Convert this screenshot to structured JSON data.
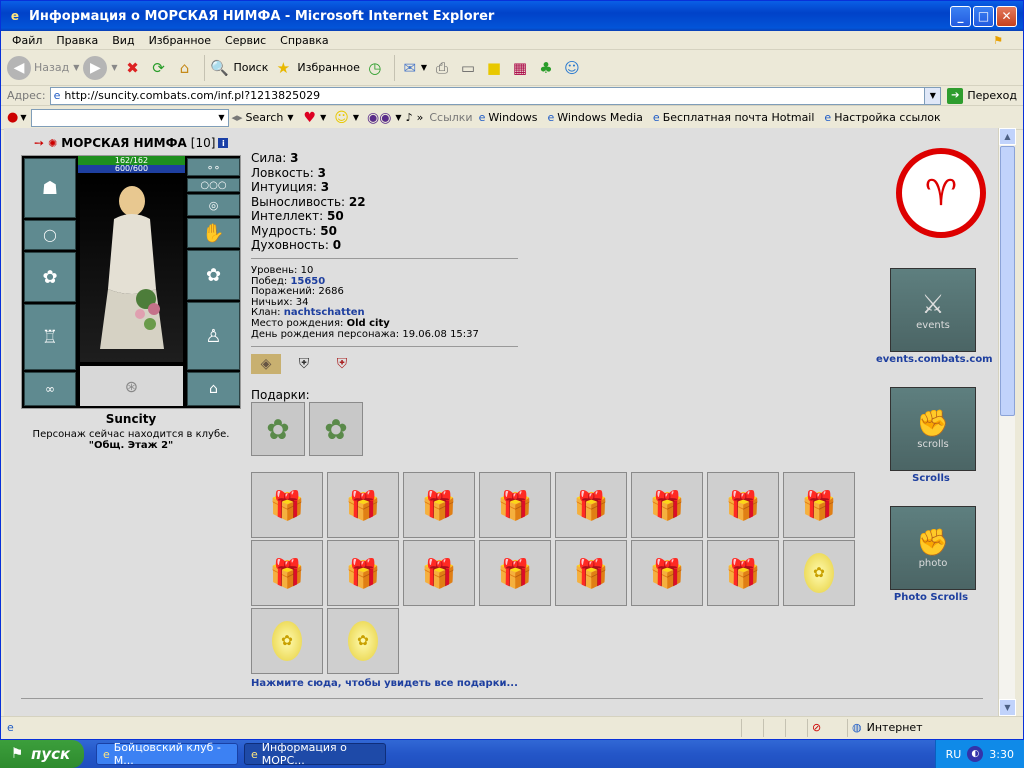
{
  "window": {
    "title": "Информация о МОРСКАЯ НИМФА - Microsoft Internet Explorer"
  },
  "menu": [
    "Файл",
    "Правка",
    "Вид",
    "Избранное",
    "Сервис",
    "Справка"
  ],
  "toolbar": {
    "back": "Назад",
    "search": "Поиск",
    "favorites": "Избранное"
  },
  "address": {
    "label": "Адрес:",
    "url": "http://suncity.combats.com/inf.pl?1213825029",
    "go": "Переход"
  },
  "links": {
    "search": "Search",
    "links_label": "Ссылки",
    "items": [
      "Windows",
      "Windows Media",
      "Бесплатная почта Hotmail",
      "Настройка ссылок"
    ]
  },
  "character": {
    "name": "МОРСКАЯ НИМФА",
    "level": "[10]",
    "hp": "162/162",
    "mp": "600/600",
    "city": "Suncity",
    "location_line": "Персонаж сейчас находится в клубе.",
    "location": "\"Общ. Этаж 2\""
  },
  "stats": [
    {
      "label": "Сила:",
      "value": "3"
    },
    {
      "label": "Ловкость:",
      "value": "3"
    },
    {
      "label": "Интуиция:",
      "value": "3"
    },
    {
      "label": "Выносливость:",
      "value": "22"
    },
    {
      "label": "Интеллект:",
      "value": "50"
    },
    {
      "label": "Мудрость:",
      "value": "50"
    },
    {
      "label": "Духовность:",
      "value": "0"
    }
  ],
  "info": {
    "level": "Уровень: 10",
    "wins_label": "Побед:",
    "wins": "15650",
    "losses": "Поражений: 2686",
    "draws": "Ничьих: 34",
    "clan_label": "Клан:",
    "clan": "nachtschatten",
    "birthplace_label": "Место рождения:",
    "birthplace": "Old city",
    "birthday": "День рождения персонажа: 19.06.08 15:37"
  },
  "gifts": {
    "label": "Подарки:",
    "see_all": "Нажмите сюда, чтобы увидеть все подарки...",
    "grid": [
      "box",
      "box",
      "box",
      "box",
      "box",
      "box",
      "box",
      "box",
      "box",
      "box",
      "box",
      "box",
      "box",
      "box",
      "box",
      "egg",
      "egg",
      "egg"
    ]
  },
  "side": {
    "events": "events.combats.com",
    "events_banner": "events",
    "scrolls": "Scrolls",
    "scrolls_banner": "scrolls",
    "photo": "Photo Scrolls",
    "photo_banner": "photo"
  },
  "status": {
    "zone": "Интернет"
  },
  "taskbar": {
    "start": "пуск",
    "tasks": [
      "Бойцовский клуб - М...",
      "Информация о МОРС..."
    ],
    "lang": "RU",
    "time": "3:30"
  }
}
